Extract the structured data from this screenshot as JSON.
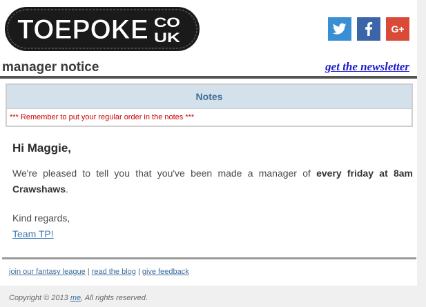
{
  "header": {
    "logo_text": "TOEPOKE",
    "logo_tld_top": "CO",
    "logo_tld_bottom": "UK",
    "social": [
      {
        "name": "twitter",
        "icon": "twitter-icon",
        "color": "#3a8ed4"
      },
      {
        "name": "facebook",
        "icon": "facebook-icon",
        "color": "#3b65a8"
      },
      {
        "name": "google-plus",
        "icon": "google-plus-icon",
        "label": "G+",
        "color": "#d94a37"
      }
    ]
  },
  "titlebar": {
    "title": "manager notice",
    "newsletter_link": "get the newsletter"
  },
  "notes": {
    "heading": "Notes",
    "text": "*** Remember to put your regular order in the notes ***"
  },
  "body": {
    "greeting": "Hi Maggie,",
    "message_prefix": "We're pleased to tell you that you've been made a manager of ",
    "message_bold": "every friday at 8am Crawshaws",
    "message_suffix": ".",
    "regards": "Kind regards,",
    "signature_link": "Team TP!"
  },
  "footer": {
    "links": [
      "join our fantasy league",
      "read the blog",
      "give feedback"
    ],
    "separator": " | ",
    "copyright_prefix": "Copyright © 2013 ",
    "copyright_link": "me",
    "copyright_suffix": ", All rights reserved."
  },
  "colors": {
    "notes_header_bg": "#d4e0ea",
    "notes_text": "#cc0000",
    "link": "#3a7ab8",
    "newsletter_link": "#1a1acc"
  }
}
